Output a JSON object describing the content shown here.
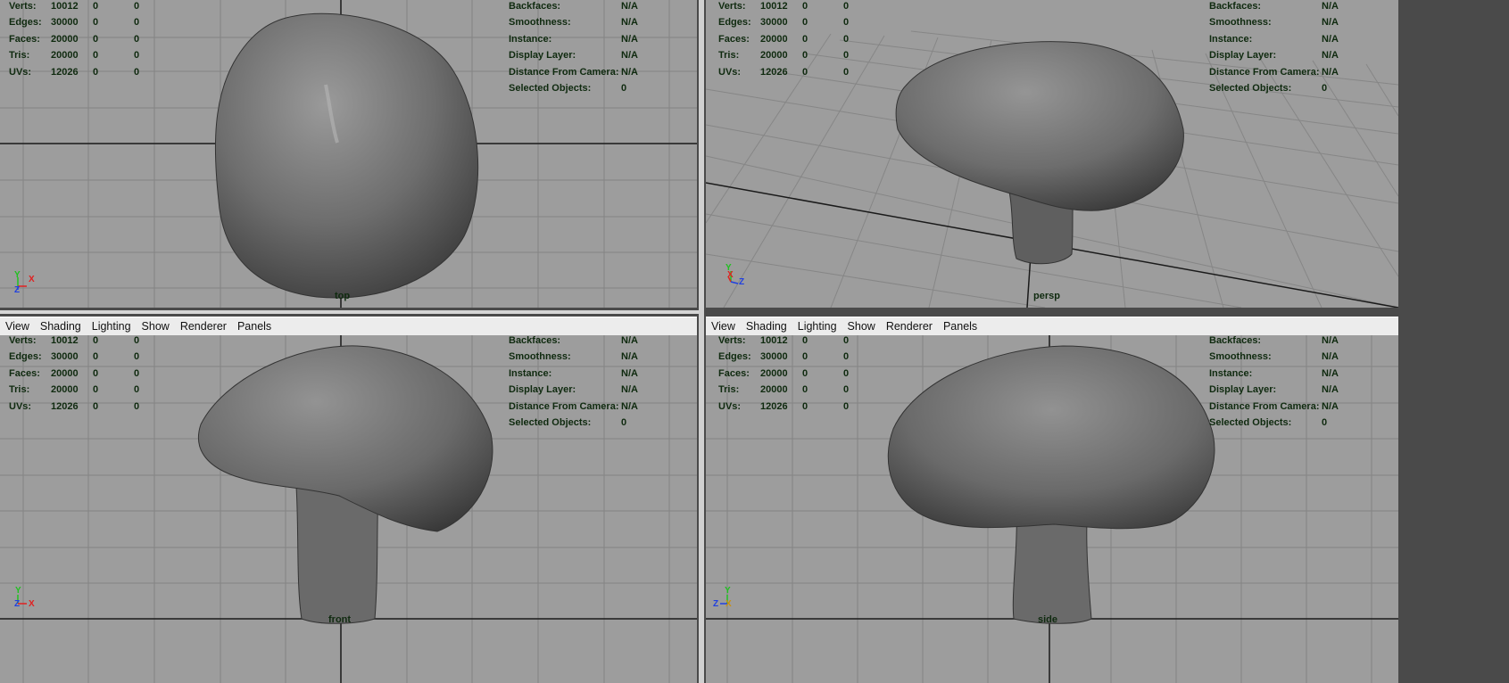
{
  "menu": [
    "View",
    "Shading",
    "Lighting",
    "Show",
    "Renderer",
    "Panels"
  ],
  "hud_left": [
    {
      "label": "Verts:",
      "v1": "10012",
      "v2": "0",
      "v3": "0"
    },
    {
      "label": "Edges:",
      "v1": "30000",
      "v2": "0",
      "v3": "0"
    },
    {
      "label": "Faces:",
      "v1": "20000",
      "v2": "0",
      "v3": "0"
    },
    {
      "label": "Tris:",
      "v1": "20000",
      "v2": "0",
      "v3": "0"
    },
    {
      "label": "UVs:",
      "v1": "12026",
      "v2": "0",
      "v3": "0"
    }
  ],
  "hud_right": [
    {
      "label": "Backfaces:",
      "value": "N/A"
    },
    {
      "label": "Smoothness:",
      "value": "N/A"
    },
    {
      "label": "Instance:",
      "value": "N/A"
    },
    {
      "label": "Display Layer:",
      "value": "N/A"
    },
    {
      "label": "Distance From Camera:",
      "value": "N/A"
    },
    {
      "label": "Selected Objects:",
      "value": "0"
    }
  ],
  "viewports": [
    {
      "name": "top",
      "camera_label": "top",
      "axes": [
        "Y",
        "X",
        "Z"
      ]
    },
    {
      "name": "persp",
      "camera_label": "persp",
      "axes": [
        "Y",
        "X",
        "Z"
      ]
    },
    {
      "name": "front",
      "camera_label": "front",
      "axes": [
        "Y",
        "Z",
        "X"
      ]
    },
    {
      "name": "side",
      "camera_label": "side",
      "axes": [
        "Y",
        "Z",
        "X"
      ]
    }
  ],
  "colors": {
    "viewport_bg": "#9d9d9d",
    "grid_line": "#7e7e7e",
    "grid_axis": "#1a1a1a",
    "mesh": "#6f6f6f",
    "hud_text": "#0f2a0f",
    "axis_x": "#e02020",
    "axis_y": "#20c020",
    "axis_z": "#2040e0"
  }
}
